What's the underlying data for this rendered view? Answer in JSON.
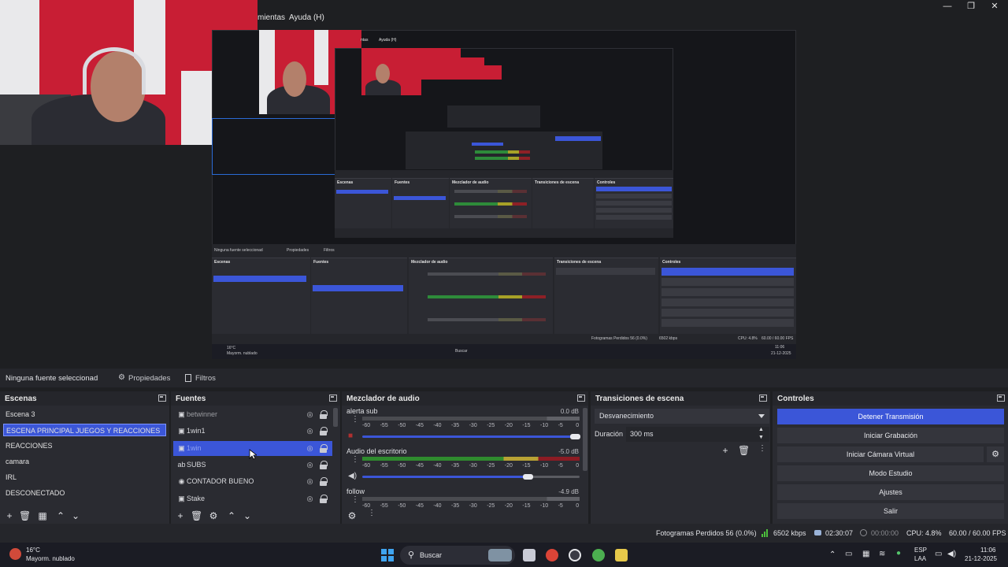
{
  "menu": {
    "tools": "mientas",
    "help": "Ayuda (H)"
  },
  "nested_menu": {
    "tools": "ntas",
    "help": "Ayuda (H)"
  },
  "window_controls": {
    "minimize": "—",
    "maximize": "❐",
    "close": "✕"
  },
  "source_toolbar": {
    "no_source": "Ninguna fuente seleccionad",
    "properties": "Propiedades",
    "filters": "Filtros"
  },
  "scenes": {
    "title": "Escenas",
    "items": [
      "Escena 3",
      "ESCENA PRINCIPAL JUEGOS Y REACCIONES",
      "REACCIONES",
      "camara",
      "IRL",
      "DESCONECTADO"
    ],
    "selected_index": 1
  },
  "sources": {
    "title": "Fuentes",
    "items": [
      {
        "name": "betwinner",
        "icon": "window-icon"
      },
      {
        "name": "1win1",
        "icon": "window-icon"
      },
      {
        "name": "1win",
        "icon": "window-icon"
      },
      {
        "name": "SUBS",
        "icon": "text-icon"
      },
      {
        "name": "CONTADOR BUENO",
        "icon": "globe-icon"
      },
      {
        "name": "Stake",
        "icon": "window-icon"
      }
    ],
    "selected_index": 2
  },
  "mixer": {
    "title": "Mezclador de audio",
    "channels": [
      {
        "name": "alerta sub",
        "db": "0.0 dB",
        "volume": 0.98
      },
      {
        "name": "Audio del escritorio",
        "db": "-5.0 dB",
        "volume": 0.76
      },
      {
        "name": "follow",
        "db": "-4.9 dB",
        "volume": 0.76
      }
    ],
    "scale": [
      "-60",
      "-55",
      "-50",
      "-45",
      "-40",
      "-35",
      "-30",
      "-25",
      "-20",
      "-15",
      "-10",
      "-5",
      "0"
    ]
  },
  "transitions": {
    "title": "Transiciones de escena",
    "type": "Desvanecimiento",
    "duration_label": "Duración",
    "duration_value": "300 ms"
  },
  "controls": {
    "title": "Controles",
    "buttons": [
      "Detener Transmisión",
      "Iniciar Grabación",
      "Iniciar Cámara Virtual",
      "Modo Estudio",
      "Ajustes",
      "Salir"
    ]
  },
  "status": {
    "dropped": "Fotogramas Perdidos 56 (0.0%)",
    "bitrate": "6502 kbps",
    "stream_time": "02:30:07",
    "rec_time": "00:00:00",
    "cpu": "CPU: 4.8%",
    "fps": "60.00 / 60.00 FPS"
  },
  "taskbar": {
    "temp": "16°C",
    "weather": "Mayorm. nublado",
    "search": "Buscar",
    "lang1": "ESP",
    "lang2": "LAA",
    "time": "11:06",
    "date": "21-12-2025"
  },
  "nested": {
    "no_source": "Ninguna fuente seleccionad",
    "properties": "Propiedades",
    "filters": "Filtros",
    "scenes_title": "Escenas",
    "sources_title": "Fuentes",
    "mixer_title": "Mezclador de audio",
    "transitions_title": "Transiciones de escena",
    "controls_title": "Controles",
    "status_dropped": "Fotogramas Perdidos 56 (0.0%)",
    "status_bitrate": "6502 kbps",
    "status_cpu": "CPU: 4.8%",
    "status_fps": "60.00 / 60.00 FPS",
    "weather_temp": "16°C",
    "weather_text": "Mayorm. nublado",
    "search": "Buscar",
    "time": "11:06",
    "date": "21-12-2025"
  },
  "colors": {
    "accent": "#3b56d8",
    "panel": "#2a2b31",
    "background": "#1e1f22"
  }
}
